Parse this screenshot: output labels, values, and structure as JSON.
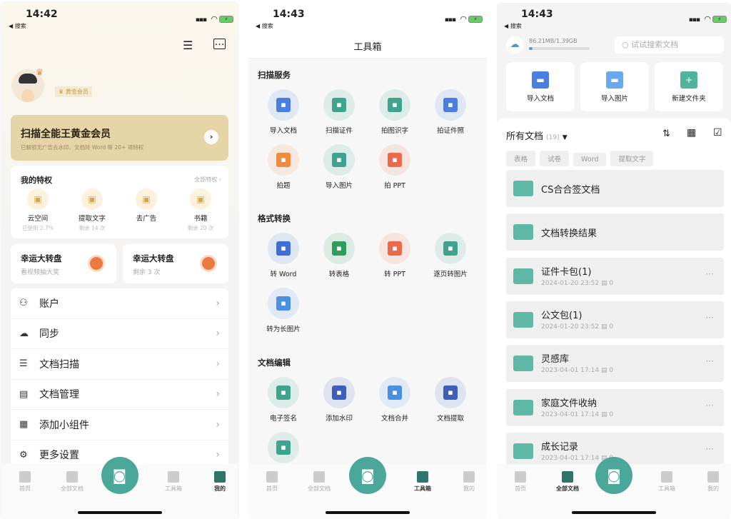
{
  "phone1": {
    "status": {
      "time": "14:42",
      "back": "◀ 搜索"
    },
    "badge": "黄金会员",
    "vip": {
      "title": "扫描全能王黄金会员",
      "subtitle": "已解锁无广告去水印、文档转 Word 等 20+ 项特权"
    },
    "privileges": {
      "title": "我的特权",
      "all": "全部特权 ›",
      "items": [
        {
          "label": "云空间",
          "sub": "已使用 2.7%",
          "icon": "cloud-upload-icon"
        },
        {
          "label": "提取文字",
          "sub": "剩余 14 次",
          "icon": "text-icon"
        },
        {
          "label": "去广告",
          "sub": "",
          "icon": "no-ad-icon"
        },
        {
          "label": "书籍",
          "sub": "剩余 20 次",
          "icon": "book-icon"
        }
      ]
    },
    "lucky": [
      {
        "title": "幸运大转盘",
        "sub": "看视频抽大奖"
      },
      {
        "title": "幸运大转盘",
        "sub": "剩余 3 次"
      }
    ],
    "menu": [
      {
        "label": "账户",
        "icon": "user-icon"
      },
      {
        "label": "同步",
        "icon": "cloud-sync-icon"
      },
      {
        "label": "文档扫描",
        "icon": "scan-icon"
      },
      {
        "label": "文档管理",
        "icon": "document-icon"
      },
      {
        "label": "添加小组件",
        "icon": "widget-icon"
      },
      {
        "label": "更多设置",
        "icon": "gear-icon"
      }
    ],
    "nav": [
      {
        "label": "首页"
      },
      {
        "label": "全部文档"
      },
      {
        "label": "工具箱"
      },
      {
        "label": "我的",
        "active": true
      }
    ]
  },
  "phone2": {
    "status": {
      "time": "14:43",
      "back": "◀ 搜索"
    },
    "title": "工具箱",
    "sections": [
      {
        "title": "扫描服务",
        "tools": [
          {
            "label": "导入文档",
            "color": "#4a7fe0"
          },
          {
            "label": "扫描证件",
            "color": "#3fa38f"
          },
          {
            "label": "拍图识字",
            "color": "#3fa38f"
          },
          {
            "label": "拍证件照",
            "color": "#4a7fe0"
          },
          {
            "label": "拍题",
            "color": "#f08a3c"
          },
          {
            "label": "导入图片",
            "color": "#3fa38f"
          },
          {
            "label": "拍 PPT",
            "color": "#ea6a4a"
          }
        ]
      },
      {
        "title": "格式转换",
        "tools": [
          {
            "label": "转 Word",
            "color": "#3e6fd8"
          },
          {
            "label": "转表格",
            "color": "#2f9d5a"
          },
          {
            "label": "转 PPT",
            "color": "#ea6a4a"
          },
          {
            "label": "逐页转图片",
            "color": "#3fa38f"
          },
          {
            "label": "转为长图片",
            "color": "#4a90e0"
          }
        ]
      },
      {
        "title": "文档编辑",
        "tools": [
          {
            "label": "电子签名",
            "color": "#3fa38f"
          },
          {
            "label": "添加水印",
            "color": "#3e5fb8"
          },
          {
            "label": "文档合并",
            "color": "#4a90e0"
          },
          {
            "label": "文档提取",
            "color": "#3e5fb8"
          },
          {
            "label": "",
            "color": "#3fa38f"
          }
        ]
      }
    ],
    "nav": [
      {
        "label": "首页"
      },
      {
        "label": "全部文档"
      },
      {
        "label": "工具箱",
        "active": true
      },
      {
        "label": "我的"
      }
    ]
  },
  "phone3": {
    "status": {
      "time": "14:43",
      "back": "◀ 搜索"
    },
    "storage": {
      "text": "86.21MB/1.39GB",
      "used_fraction": 0.06
    },
    "search_placeholder": "试试搜索文档",
    "quick": [
      {
        "label": "导入文档",
        "color": "#4a7fe0"
      },
      {
        "label": "导入图片",
        "color": "#6aa8f0"
      },
      {
        "label": "新建文件夹",
        "color": "#4fb39e"
      }
    ],
    "list": {
      "title": "所有文档",
      "count": "(19)",
      "chips": [
        "表格",
        "试卷",
        "Word",
        "提取文字"
      ]
    },
    "folders": [
      {
        "name": "CS合合签文档",
        "date": "",
        "count": ""
      },
      {
        "name": "文档转换结果",
        "date": "",
        "count": ""
      },
      {
        "name": "证件卡包(1)",
        "date": "2024-01-20 23:52",
        "count": "0"
      },
      {
        "name": "公文包(1)",
        "date": "2024-01-20 23:52",
        "count": "0"
      },
      {
        "name": "灵感库",
        "date": "2023-04-01 17:14",
        "count": "0"
      },
      {
        "name": "家庭文件收纳",
        "date": "2023-04-01 17:14",
        "count": "0"
      },
      {
        "name": "成长记录",
        "date": "2023-04-01 17:14",
        "count": "0"
      }
    ],
    "nav": [
      {
        "label": "首页"
      },
      {
        "label": "全部文档",
        "active": true
      },
      {
        "label": "工具箱"
      },
      {
        "label": "我的"
      }
    ]
  }
}
